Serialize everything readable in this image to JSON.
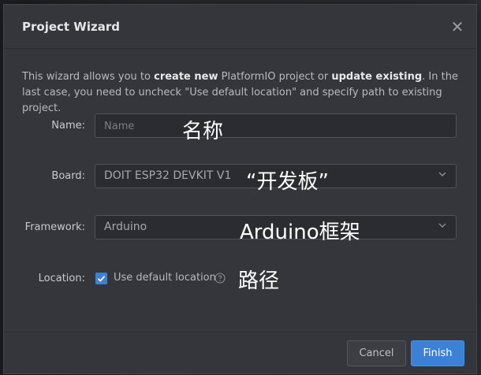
{
  "dialog": {
    "title": "Project Wizard",
    "close_symbol": "✕",
    "intro": {
      "part1": "This wizard allows you to ",
      "bold1": "create new",
      "part2": " PlatformIO project or ",
      "bold2": "update existing",
      "part3": ". In the last case, you need to uncheck \"Use default location\" and specify path to existing project."
    }
  },
  "form": {
    "name": {
      "label": "Name:",
      "placeholder": "Name",
      "value": "",
      "annotation": "名称"
    },
    "board": {
      "label": "Board:",
      "value": "DOIT ESP32 DEVKIT V1",
      "annotation": "“开发板”"
    },
    "framework": {
      "label": "Framework:",
      "value": "Arduino",
      "annotation": "Arduino框架"
    },
    "location": {
      "label": "Location:",
      "checkbox_label": "Use default location",
      "checked": true,
      "annotation": "路径"
    }
  },
  "buttons": {
    "cancel": "Cancel",
    "finish": "Finish"
  },
  "colors": {
    "accent": "#3b82d6",
    "dialog_bg": "#35363b",
    "field_bg": "#2b2c30"
  },
  "icons": [
    "close-icon",
    "chevron-down-icon",
    "check-icon",
    "help-icon"
  ]
}
